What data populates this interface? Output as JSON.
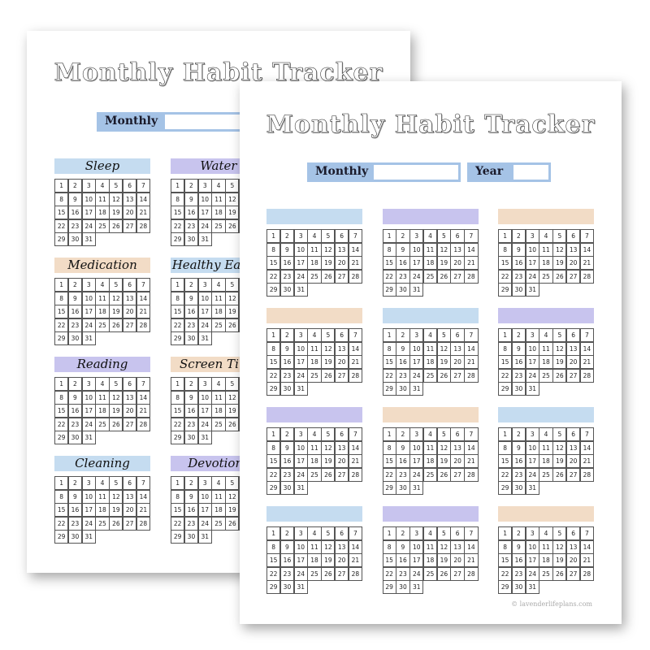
{
  "colors": {
    "blue": "#c5dcf0",
    "purple": "#c8c4ee",
    "peach": "#f2dcc6",
    "field": "#a5c3e6"
  },
  "days": [
    "1",
    "2",
    "3",
    "4",
    "5",
    "6",
    "7",
    "8",
    "9",
    "10",
    "11",
    "12",
    "13",
    "14",
    "15",
    "16",
    "17",
    "18",
    "19",
    "20",
    "21",
    "22",
    "23",
    "24",
    "25",
    "26",
    "27",
    "28",
    "29",
    "30",
    "31"
  ],
  "back_page": {
    "title": "Monthly Habit Tracker",
    "month_label": "Monthly",
    "trackers": [
      {
        "label": "Sleep",
        "color": "blue"
      },
      {
        "label": "Water",
        "color": "purple"
      },
      {
        "label": "Medication",
        "color": "peach"
      },
      {
        "label": "Healthy Eating",
        "color": "blue"
      },
      {
        "label": "Reading",
        "color": "purple"
      },
      {
        "label": "Screen Time",
        "color": "peach"
      },
      {
        "label": "Cleaning",
        "color": "blue"
      },
      {
        "label": "Devotions",
        "color": "purple"
      }
    ]
  },
  "front_page": {
    "title": "Monthly Habit Tracker",
    "month_label": "Monthly",
    "year_label": "Year",
    "trackers": [
      {
        "label": "",
        "color": "blue"
      },
      {
        "label": "",
        "color": "purple"
      },
      {
        "label": "",
        "color": "peach"
      },
      {
        "label": "",
        "color": "peach"
      },
      {
        "label": "",
        "color": "blue"
      },
      {
        "label": "",
        "color": "purple"
      },
      {
        "label": "",
        "color": "purple"
      },
      {
        "label": "",
        "color": "peach"
      },
      {
        "label": "",
        "color": "blue"
      },
      {
        "label": "",
        "color": "blue"
      },
      {
        "label": "",
        "color": "purple"
      },
      {
        "label": "",
        "color": "peach"
      }
    ],
    "copyright": "© lavenderlifeplans.com"
  }
}
